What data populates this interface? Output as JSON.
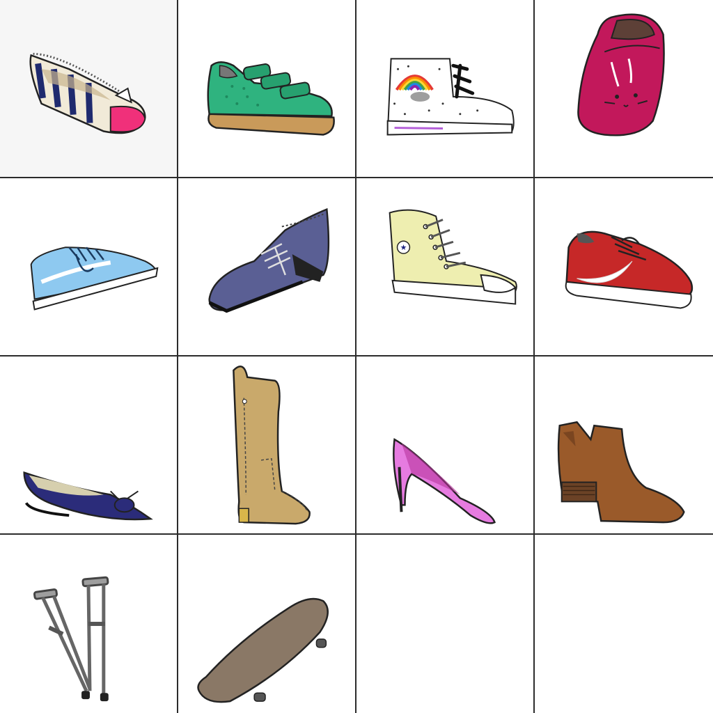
{
  "grid": {
    "rows": 4,
    "columns": 4,
    "tiles": [
      {
        "icon": "striped-ballet-flat-icon",
        "color": "#1f2a6e"
      },
      {
        "icon": "green-velcro-sneaker-icon",
        "color": "#2fb37f"
      },
      {
        "icon": "rainbow-high-top-sneaker-icon",
        "color": "#ffffff"
      },
      {
        "icon": "pink-bunny-baby-shoe-icon",
        "color": "#c2185b"
      },
      {
        "icon": "light-blue-skate-shoe-icon",
        "color": "#8ec9f0"
      },
      {
        "icon": "navy-oxford-shoe-icon",
        "color": "#5a5f94"
      },
      {
        "icon": "yellow-high-top-sneaker-icon",
        "color": "#eeeeb0"
      },
      {
        "icon": "red-running-shoe-icon",
        "color": "#c62828"
      },
      {
        "icon": "navy-pointed-flat-icon",
        "color": "#2b2c7a"
      },
      {
        "icon": "tan-knee-high-boot-icon",
        "color": "#c9a96b"
      },
      {
        "icon": "pink-stiletto-pump-icon",
        "color": "#e67be0"
      },
      {
        "icon": "brown-ankle-bootie-icon",
        "color": "#9a5a2a"
      },
      {
        "icon": "crutches-icon",
        "color": "#9e9e9e"
      },
      {
        "icon": "skateboard-icon",
        "color": "#8a7866"
      },
      {
        "icon": "empty-tile",
        "color": "#ffffff"
      },
      {
        "icon": "empty-tile",
        "color": "#ffffff"
      }
    ]
  }
}
